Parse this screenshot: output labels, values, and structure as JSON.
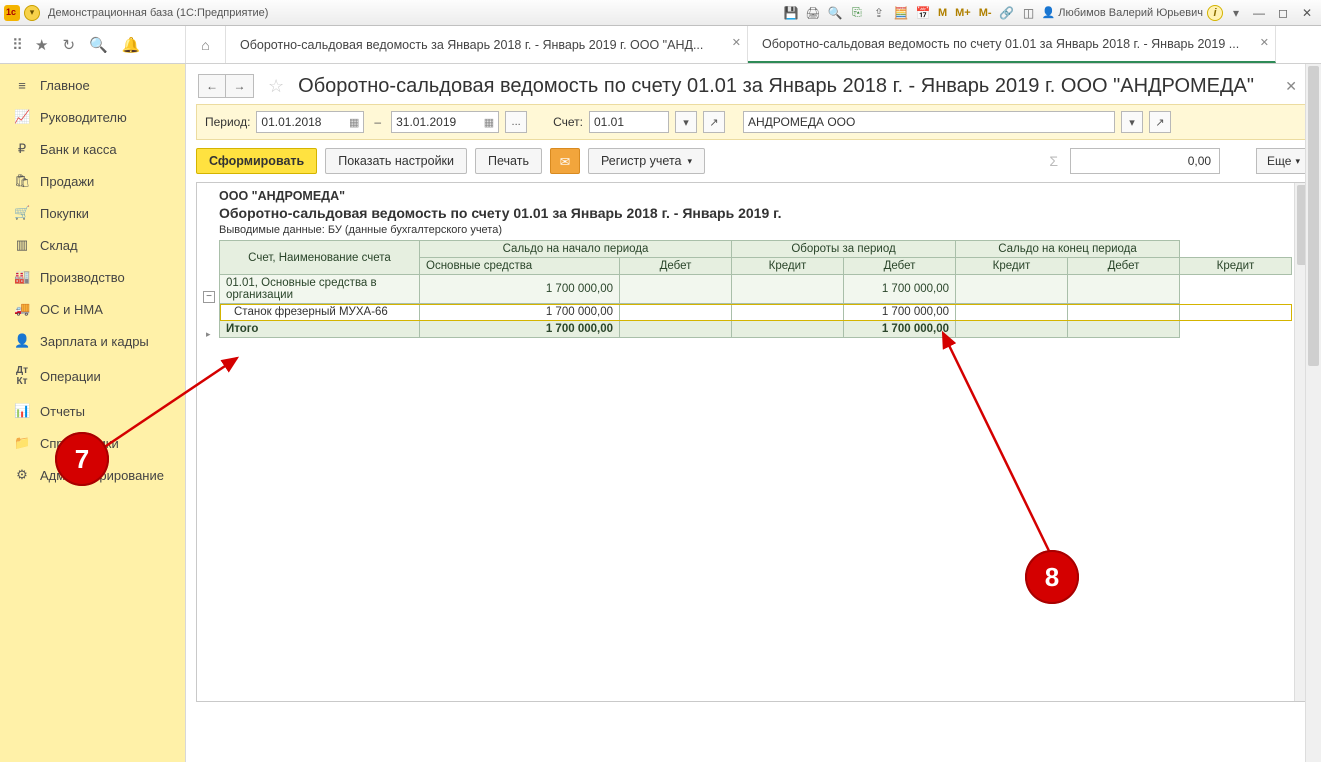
{
  "titlebar": {
    "app_title": "Демонстрационная база  (1С:Предприятие)",
    "m_labels": [
      "M",
      "M+",
      "M-"
    ],
    "user_name": "Любимов Валерий Юрьевич"
  },
  "tabs": {
    "tab1_label": "Оборотно-сальдовая ведомость за Январь 2018 г. - Январь 2019 г. ООО \"АНД...",
    "tab2_label": "Оборотно-сальдовая ведомость по счету 01.01 за Январь 2018 г. - Январь 2019 ..."
  },
  "sidebar": {
    "items": [
      {
        "label": "Главное"
      },
      {
        "label": "Руководителю"
      },
      {
        "label": "Банк и касса"
      },
      {
        "label": "Продажи"
      },
      {
        "label": "Покупки"
      },
      {
        "label": "Склад"
      },
      {
        "label": "Производство"
      },
      {
        "label": "ОС и НМА"
      },
      {
        "label": "Зарплата и кадры"
      },
      {
        "label": "Операции"
      },
      {
        "label": "Отчеты"
      },
      {
        "label": "Справочники"
      },
      {
        "label": "Администрирование"
      }
    ]
  },
  "page": {
    "title": "Оборотно-сальдовая ведомость по счету 01.01 за Январь 2018 г. - Январь 2019 г. ООО \"АНДРОМЕДА\""
  },
  "params": {
    "period_label": "Период:",
    "date_from": "01.01.2018",
    "date_to": "31.01.2019",
    "dots": "...",
    "account_label": "Счет:",
    "account_value": "01.01",
    "org_value": "АНДРОМЕДА ООО"
  },
  "buttons": {
    "form": "Сформировать",
    "show_settings": "Показать настройки",
    "print": "Печать",
    "register": "Регистр учета",
    "sum_value": "0,00",
    "more": "Еще"
  },
  "report": {
    "org_title": "ООО \"АНДРОМЕДА\"",
    "rep_title": "Оборотно-сальдовая ведомость по счету 01.01 за Январь 2018 г. - Январь 2019 г.",
    "subline": "Выводимые данные:  БУ (данные бухгалтерского учета)",
    "headers": {
      "account": "Счет, Наименование счета",
      "saldo_begin": "Сальдо на начало периода",
      "turnover": "Обороты за период",
      "saldo_end": "Сальдо на конец периода",
      "debit": "Дебет",
      "credit": "Кредит",
      "group_row": "Основные средства"
    },
    "rows": {
      "acct_row_name": "01.01, Основные средства в организации",
      "acct_row_debit_begin": "1 700 000,00",
      "acct_row_credit_turn": "1 700 000,00",
      "detail_name": "Станок фрезерный МУХА-66",
      "detail_debit_begin": "1 700 000,00",
      "detail_credit_turn": "1 700 000,00",
      "total_label": "Итого",
      "total_debit_begin": "1 700 000,00",
      "total_credit_turn": "1 700 000,00"
    }
  },
  "annotations": {
    "a7": "7",
    "a8": "8"
  }
}
